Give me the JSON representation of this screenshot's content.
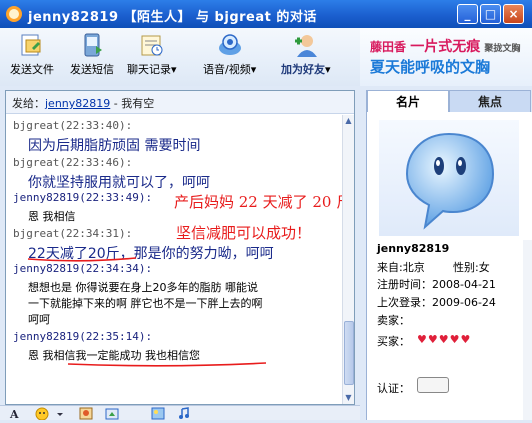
{
  "window": {
    "title": "jenny82819 【陌生人】 与 bjgreat 的对话",
    "min_label": "_",
    "max_label": "□",
    "close_label": "×"
  },
  "toolbar": {
    "buttons": [
      {
        "label": "发送文件",
        "icon": "send-file-icon"
      },
      {
        "label": "发送短信",
        "icon": "send-sms-icon"
      },
      {
        "label": "聊天记录",
        "icon": "chat-history-icon",
        "has_dropdown": true
      },
      {
        "label": "语音/视频",
        "icon": "voice-video-icon",
        "has_dropdown": true
      },
      {
        "label": "加为好友",
        "icon": "add-friend-icon",
        "has_dropdown": true
      }
    ],
    "dropdown_glyph": "▾"
  },
  "banner": {
    "brand": "藤田香",
    "slogan_big": "一片式无痕",
    "slogan_small": "聚拢文胸",
    "line2": "夏天能呼吸的文胸"
  },
  "chat": {
    "header_prefix": "发给：",
    "header_user": "jenny82819",
    "header_status": " - 我有空",
    "messages": [
      {
        "sender": "bjgreat(22:33:40):",
        "text": "因为后期脂肪顽固  需要时间"
      },
      {
        "sender": "bjgreat(22:33:46):",
        "text": "你就坚持服用就可以了，呵呵"
      },
      {
        "sender": "jenny82819(22:33:49):",
        "text": "恩  我相信"
      },
      {
        "sender": "bjgreat(22:34:31):",
        "text": "22天减了20斤，那是你的努力呦，呵呵"
      },
      {
        "sender": "jenny82819(22:34:34):",
        "text_lines": [
          "想想也是   你得说要在身上20多年的脂肪  哪能说",
          "一下就能掉下来的啊   胖它也不是一下胖上去的啊",
          "呵呵"
        ]
      },
      {
        "sender": "jenny82819(22:35:14):",
        "text": "恩   我相信我一定能成功   我也相信您"
      }
    ],
    "annotations": [
      "产后妈妈 22 天减了 20 斤！",
      "坚信减肥可以成功！"
    ],
    "accent_color": "#e81c1c"
  },
  "bottom_toolbar": {
    "icons": [
      "font-icon",
      "emoticon-icon",
      "dropdown-icon",
      "scrawl-icon",
      "screenshot-icon",
      "picture-icon",
      "music-icon"
    ]
  },
  "profile": {
    "tabs": [
      "名片",
      "焦点"
    ],
    "username": "jenny82819",
    "from_label": "来自:",
    "from_value": "北京",
    "gender_label": "性别:",
    "gender_value": "女",
    "register_label": "注册时间：",
    "register_value": "2008-04-21",
    "last_login_label": "上次登录：",
    "last_login_value": "2009-06-24",
    "seller_label": "卖家：",
    "buyer_label": "买家：",
    "cert_label": "认证："
  }
}
